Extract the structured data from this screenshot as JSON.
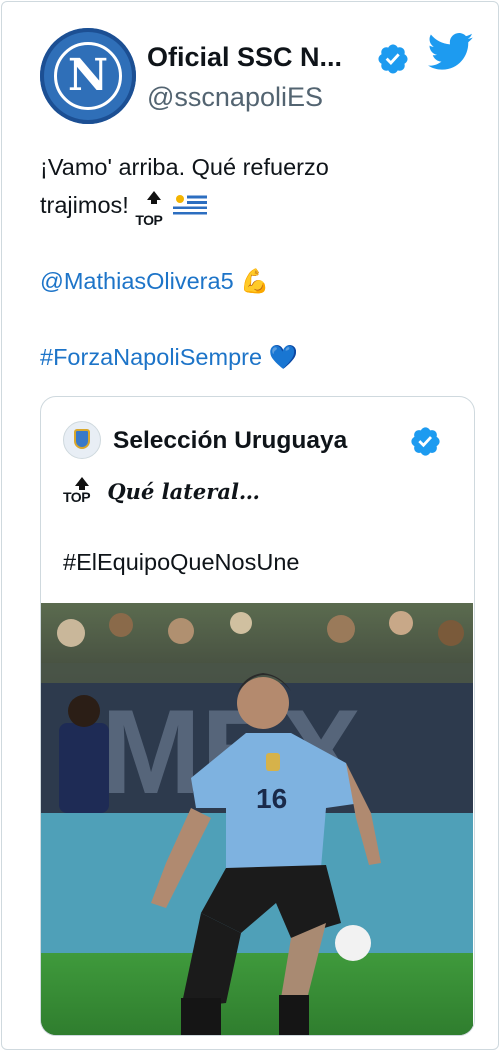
{
  "tweet": {
    "author_name": "Oficial SSC N...",
    "author_handle": "@sscnapoliES",
    "avatar_letter": "N",
    "text_line1": "¡Vamo' arriba. Qué refuerzo",
    "text_line2": "trajimos!",
    "emoji_top_label": "TOP",
    "mention": "@MathiasOlivera5",
    "mention_emoji": "💪",
    "hashtag": "#ForzaNapoliSempre",
    "hashtag_emoji": "💙",
    "colors": {
      "link": "#1d74c8",
      "verified": "#1d9bf0",
      "twitter": "#1d9bf0"
    }
  },
  "quoted": {
    "author_name": "Selección Uruguaya",
    "emoji_top_label": "TOP",
    "text_line1": "Qué lateral…",
    "text_line2": "#ElEquipoQueNosUne",
    "photo": {
      "jersey_number": "16",
      "banner_text": "MEX"
    }
  }
}
